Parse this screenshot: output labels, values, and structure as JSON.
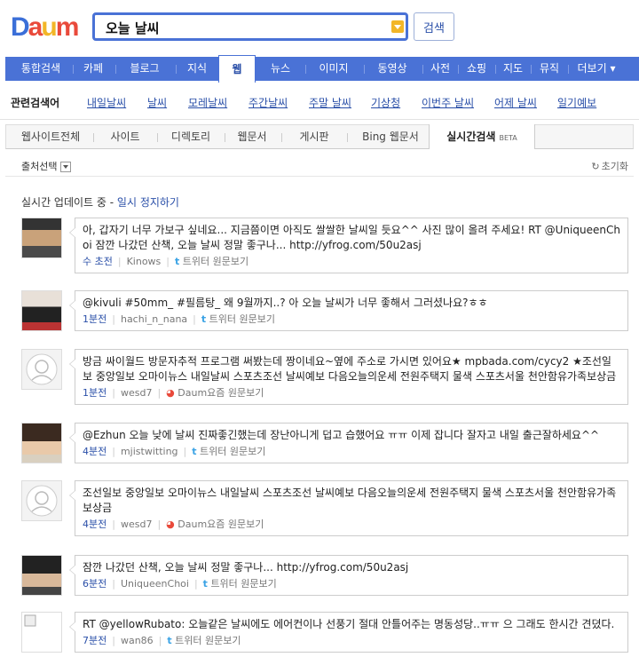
{
  "logo": "Daum",
  "search": {
    "query": "오늘 날씨",
    "button": "검색"
  },
  "nav": [
    "통합검색",
    "카페",
    "블로그",
    "지식",
    "웹",
    "뉴스",
    "이미지",
    "동영상",
    "사전",
    "쇼핑",
    "지도",
    "뮤직",
    "더보기 ▾"
  ],
  "nav_active": "웹",
  "related": {
    "label": "관련검색어",
    "items": [
      "내일날씨",
      "날씨",
      "모레날씨",
      "주간날씨",
      "주말 날씨",
      "기상청",
      "이번주 날씨",
      "어제 날씨",
      "일기예보"
    ]
  },
  "tabs": [
    "웹사이트전체",
    "사이트",
    "디렉토리",
    "웹문서",
    "게시판",
    "Bing 웹문서",
    "실시간검색"
  ],
  "tab_beta": "BETA",
  "filter": {
    "label": "출처선택",
    "reset": "초기화"
  },
  "update": {
    "prefix": "실시간 업데이트 중 - ",
    "link": "일시 정지하기"
  },
  "results": [
    {
      "text": "아, 갑자기 너무 가보구 싶네요... 지금쯤이면 아직도 쌀쌀한 날씨일 듯요^^ 사진 많이 올려 주세요! RT @UniqueenChoi 잠깐 나갔던 산책, 오늘 날씨 정말 좋구나... http://yfrog.com/50u2asj",
      "time": "수 초전",
      "user": "Kinows",
      "source": "트위터 원문보기",
      "source_type": "twitter"
    },
    {
      "text": "@kivuli #50mm_ #필름탕_ 왜 9월까지..? 아 오늘 날씨가 너무 좋해서 그러셨나요?ㅎㅎ",
      "time": "1분전",
      "user": "hachi_n_nana",
      "source": "트위터 원문보기",
      "source_type": "twitter"
    },
    {
      "text": "방금 싸이월드 방문자추적 프로그램 써봤는데 짱이네요~옆에 주소로 가시면 있어요★ mpbada.com/cycy2 ★조선일보 중앙일보 오마이뉴스 내일날씨 스포츠조선 날씨예보 다음오늘의운세 전원주택지 물색 스포츠서울 천안함유가족보상금",
      "time": "1분전",
      "user": "wesd7",
      "source": "Daum요즘 원문보기",
      "source_type": "daum"
    },
    {
      "text": "@Ezhun 오늘 낮에 날씨 진짜좋긴했는데 장난아니게 덥고 습했어요 ㅠㅠ 이제 잡니다 잘자고 내일 출근잘하세요^^",
      "time": "4분전",
      "user": "mjistwitting",
      "source": "트위터 원문보기",
      "source_type": "twitter"
    },
    {
      "text": "조선일보 중앙일보 오마이뉴스 내일날씨 스포츠조선 날씨예보 다음오늘의운세 전원주택지 물색 스포츠서울 천안함유가족보상금",
      "time": "4분전",
      "user": "wesd7",
      "source": "Daum요즘 원문보기",
      "source_type": "daum"
    },
    {
      "text": "잠깐 나갔던 산책, 오늘 날씨 정말 좋구나... http://yfrog.com/50u2asj",
      "time": "6분전",
      "user": "UniqueenChoi",
      "source": "트위터 원문보기",
      "source_type": "twitter"
    },
    {
      "text": "RT @yellowRubato: 오늘같은 날씨에도 에어컨이나 선풍기 절대 안틀어주는 명동성당..ㅠㅠ 으 그래도 한시간 견뎠다.",
      "time": "7분전",
      "user": "wan86",
      "source": "트위터 원문보기",
      "source_type": "twitter"
    }
  ]
}
